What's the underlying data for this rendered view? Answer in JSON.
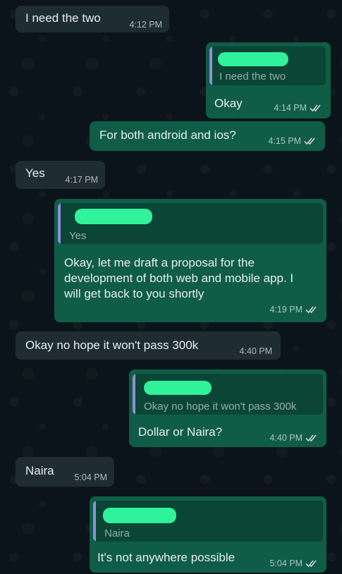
{
  "messages": [
    {
      "id": "m1",
      "direction": "incoming",
      "text": "I need the two",
      "time": "4:12 PM"
    },
    {
      "id": "m2",
      "direction": "outgoing",
      "quoted_text": "I need the two",
      "text": "Okay",
      "time": "4:14 PM",
      "status_icon": "double-check-icon"
    },
    {
      "id": "m3",
      "direction": "outgoing",
      "text": "For both android and ios?",
      "time": "4:15 PM",
      "status_icon": "double-check-icon"
    },
    {
      "id": "m4",
      "direction": "incoming",
      "text": "Yes",
      "time": "4:17 PM"
    },
    {
      "id": "m5",
      "direction": "outgoing",
      "quoted_text": "Yes",
      "text": "Okay, let me draft a proposal for the development of both web and mobile app. I will get back to you shortly",
      "time": "4:19 PM",
      "status_icon": "double-check-icon"
    },
    {
      "id": "m6",
      "direction": "incoming",
      "text": "Okay no hope it won't pass 300k",
      "time": "4:40 PM"
    },
    {
      "id": "m7",
      "direction": "outgoing",
      "quoted_text": "Okay no hope it won't pass 300k",
      "text": "Dollar or Naira?",
      "time": "4:40 PM",
      "status_icon": "double-check-icon"
    },
    {
      "id": "m8",
      "direction": "incoming",
      "text": "Naira",
      "time": "5:04 PM"
    },
    {
      "id": "m9",
      "direction": "outgoing",
      "quoted_text": "Naira",
      "text": "It's not anywhere possible",
      "time": "5:04 PM",
      "status_icon": "double-check-icon"
    }
  ],
  "colors": {
    "background": "#0b141a",
    "incoming_bubble": "#1f2c34",
    "outgoing_bubble": "#0f5d46",
    "quote_bar": "#8f8fd8",
    "redaction": "#2ff29a",
    "read_ticks": "#cfd6d9"
  }
}
